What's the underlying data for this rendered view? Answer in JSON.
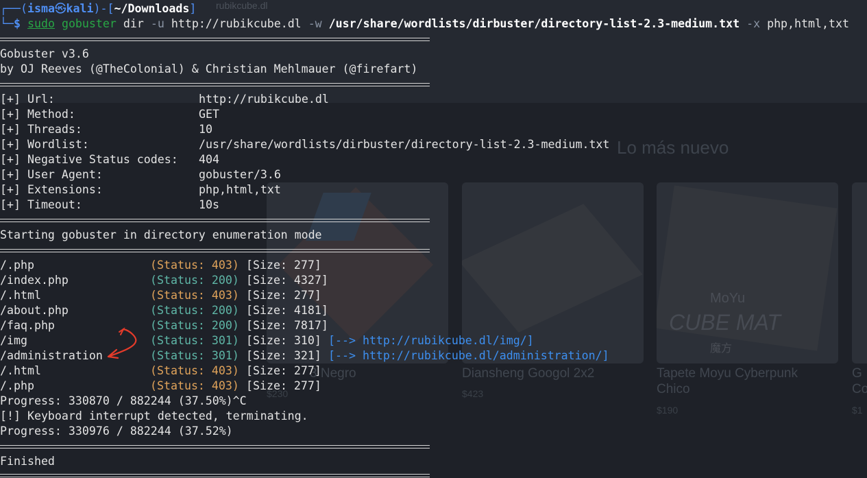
{
  "background_page": {
    "tab_title": "rubikcube.dl",
    "section_title": "Lo más nuevo",
    "cards": [
      {
        "name": "3 Negro",
        "price": "$230"
      },
      {
        "name": "Diansheng Googol 2x2",
        "price": "$423"
      },
      {
        "name": "Tapete Moyu Cyberpunk\nChico",
        "price": "$190",
        "image_text_1": "MoYu",
        "image_text_2": "CUBE MAT",
        "image_text_3": "魔方"
      },
      {
        "name": "G\nCo",
        "price": "$1"
      }
    ]
  },
  "prompt": {
    "corner_top": "┌──(",
    "user": "isma",
    "at_symbol": "㉿",
    "host": "kali",
    "mid": ")-[",
    "cwd": "~/Downloads",
    "close": "]",
    "corner_bottom": "└─",
    "dollar": "$",
    "cmd_sudo": "sudo",
    "cmd_tool": "gobuster",
    "cmd_mode": "dir",
    "flag_u": "-u",
    "url_arg": "http://rubikcube.dl",
    "flag_w": "-w",
    "wordlist_arg": "/usr/share/wordlists/dirbuster/directory-list-2.3-medium.txt",
    "flag_x": "-x",
    "ext_arg": "php,html,txt"
  },
  "banner": {
    "version": "Gobuster v3.6",
    "authors": "by OJ Reeves (@TheColonial) & Christian Mehlmauer (@firefart)"
  },
  "config": [
    {
      "key": "[+] Url:",
      "value": "http://rubikcube.dl"
    },
    {
      "key": "[+] Method:",
      "value": "GET"
    },
    {
      "key": "[+] Threads:",
      "value": "10"
    },
    {
      "key": "[+] Wordlist:",
      "value": "/usr/share/wordlists/dirbuster/directory-list-2.3-medium.txt"
    },
    {
      "key": "[+] Negative Status codes:",
      "value": "404"
    },
    {
      "key": "[+] User Agent:",
      "value": "gobuster/3.6"
    },
    {
      "key": "[+] Extensions:",
      "value": "php,html,txt"
    },
    {
      "key": "[+] Timeout:",
      "value": "10s"
    }
  ],
  "start_msg": "Starting gobuster in directory enumeration mode",
  "results": [
    {
      "path": "/.php",
      "status": "(Status: 403)",
      "size": "[Size: 277]",
      "redirect": ""
    },
    {
      "path": "/index.php",
      "status": "(Status: 200)",
      "size": "[Size: 4327]",
      "redirect": ""
    },
    {
      "path": "/.html",
      "status": "(Status: 403)",
      "size": "[Size: 277]",
      "redirect": ""
    },
    {
      "path": "/about.php",
      "status": "(Status: 200)",
      "size": "[Size: 4181]",
      "redirect": ""
    },
    {
      "path": "/faq.php",
      "status": "(Status: 200)",
      "size": "[Size: 7817]",
      "redirect": ""
    },
    {
      "path": "/img",
      "status": "(Status: 301)",
      "size": "[Size: 310]",
      "redirect": "[--> http://rubikcube.dl/img/]"
    },
    {
      "path": "/administration",
      "status": "(Status: 301)",
      "size": "[Size: 321]",
      "redirect": "[--> http://rubikcube.dl/administration/]"
    },
    {
      "path": "/.html",
      "status": "(Status: 403)",
      "size": "[Size: 277]",
      "redirect": ""
    },
    {
      "path": "/.php",
      "status": "(Status: 403)",
      "size": "[Size: 277]",
      "redirect": ""
    }
  ],
  "progress_1": "Progress: 330870 / 882244 (37.50%)^C",
  "interrupt": "[!] Keyboard interrupt detected, terminating.",
  "progress_2": "Progress: 330976 / 882244 (37.52%)",
  "finished": "Finished",
  "colors": {
    "status_403": "#e0a35a",
    "status_200": "#56b6c2",
    "status_301": "#56b6c2",
    "link": "#3d8ff0",
    "annotation": "#e53b2a"
  },
  "annotation": {
    "arrow_count": 2
  }
}
